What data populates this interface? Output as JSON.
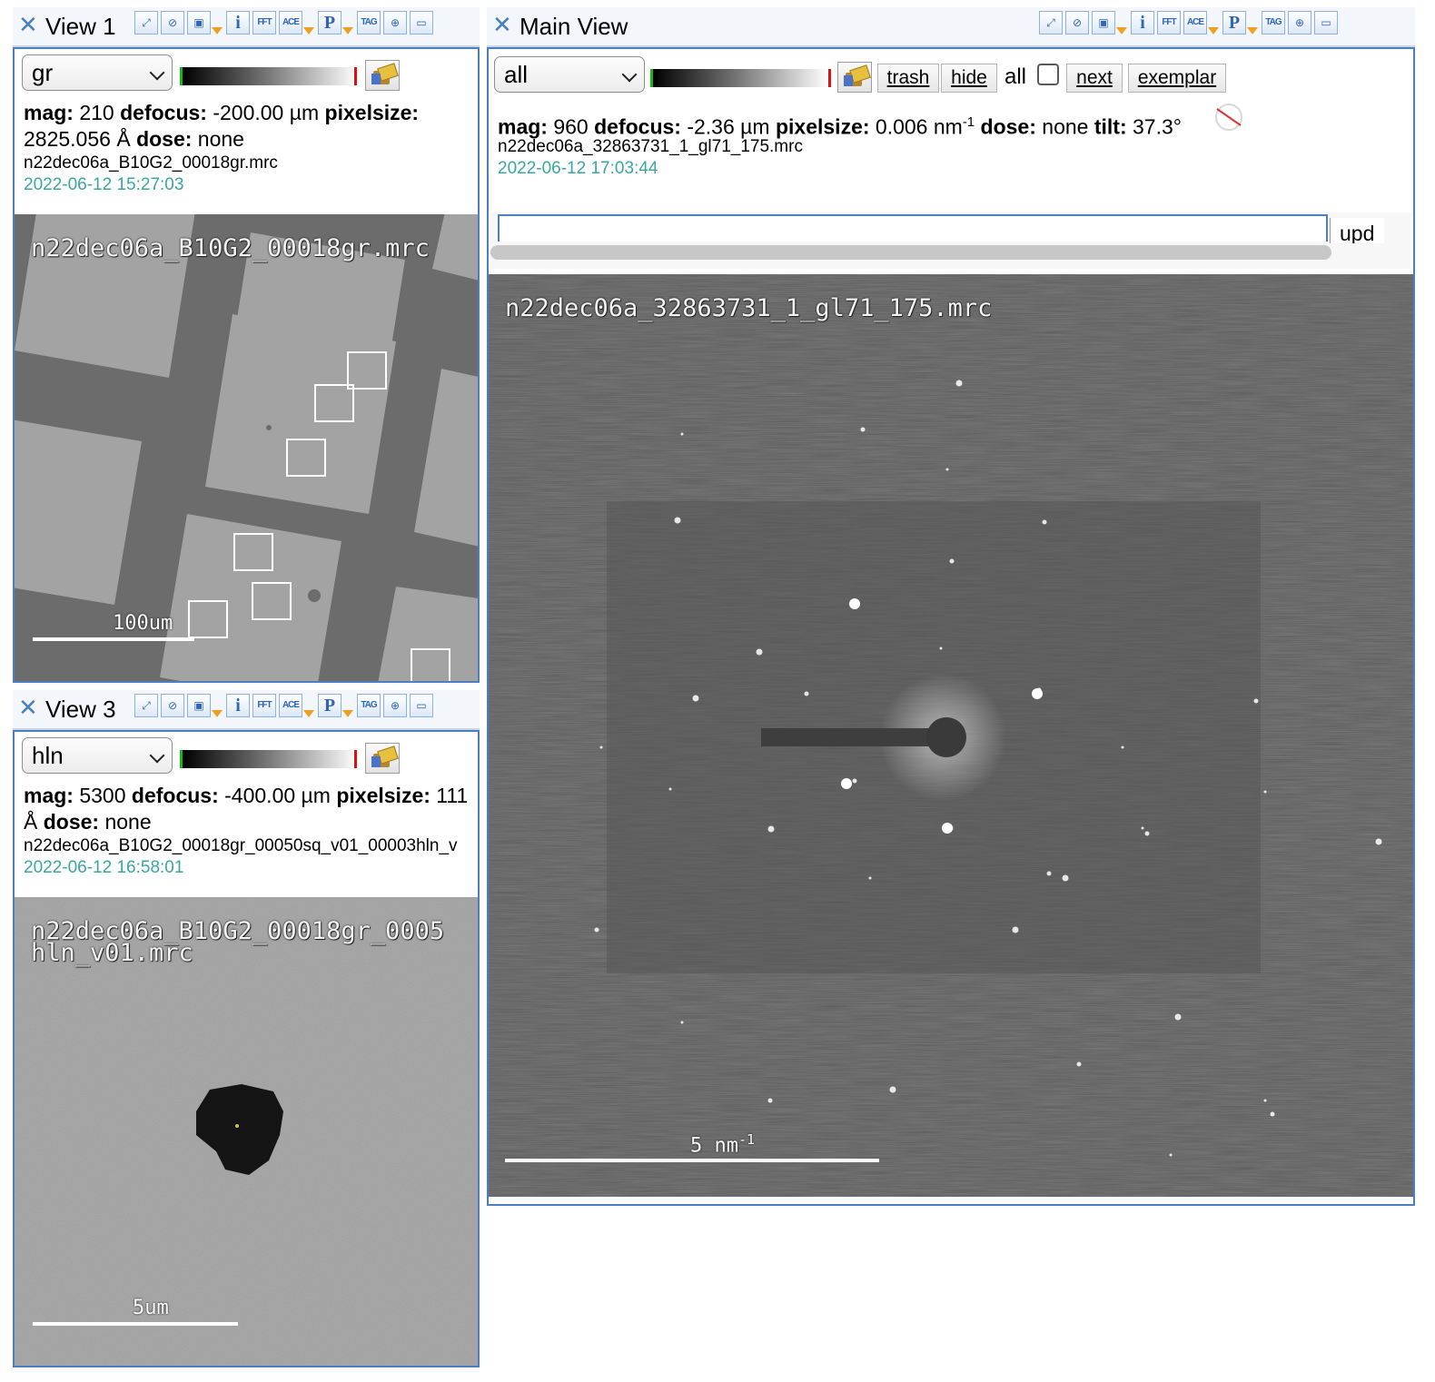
{
  "toolbar_icons": [
    "zoom-fit-icon",
    "crosshair-cancel-icon",
    "save-icon",
    "info-icon",
    "fft-icon",
    "ace-icon",
    "p-icon",
    "tag-icon",
    "target-icon",
    "panel-minimize-icon"
  ],
  "toolbar_labels": {
    "info": "i",
    "fft": "FFT",
    "ace": "ACE",
    "p": "P",
    "tag": "TAG"
  },
  "views": {
    "view1": {
      "title": "View 1",
      "preset": "gr",
      "mag_label": "mag:",
      "mag": "210",
      "defocus_label": "defocus:",
      "defocus": "-200.00 µm",
      "pixelsize_label": "pixelsize:",
      "pixelsize": "2825.056 Å",
      "dose_label": "dose:",
      "dose": "none",
      "filename": "n22dec06a_B10G2_00018gr.mrc",
      "timestamp": "2022-06-12 15:27:03",
      "overlay_filename": "n22dec06a_B10G2_00018gr.mrc",
      "scale_label": "100um"
    },
    "view3": {
      "title": "View 3",
      "preset": "hln",
      "mag_label": "mag:",
      "mag": "5300",
      "defocus_label": "defocus:",
      "defocus": "-400.00 µm",
      "pixelsize_label": "pixelsize:",
      "pixelsize": "111",
      "pixelsize_unit": "Å",
      "dose_label": "dose:",
      "dose": "none",
      "filename": "n22dec06a_B10G2_00018gr_00050sq_v01_00003hln_v",
      "timestamp": "2022-06-12 16:58:01",
      "overlay_line1": "n22dec06a_B10G2_00018gr_0005",
      "overlay_line2": "hln_v01.mrc",
      "scale_label": "5um"
    },
    "main": {
      "title": "Main View",
      "preset": "all",
      "buttons": {
        "trash": "trash",
        "hide": "hide",
        "next": "next",
        "exemplar": "exemplar"
      },
      "all_label": "all",
      "mag_label": "mag:",
      "mag": "960",
      "defocus_label": "defocus:",
      "defocus": "-2.36 µm",
      "pixelsize_label": "pixelsize:",
      "pixelsize": "0.006 nm",
      "pixelsize_exp": "-1",
      "dose_label": "dose:",
      "dose": "none",
      "tilt_label": "tilt:",
      "tilt": "37.3°",
      "filename": "n22dec06a_32863731_1_gl71_175.mrc",
      "timestamp": "2022-06-12 17:03:44",
      "comment_value": "",
      "update_label": "upd",
      "overlay_filename": "n22dec06a_32863731_1_gl71_175.mrc",
      "scale_label": "5 nm",
      "scale_exp": "-1"
    }
  },
  "colors": {
    "accent": "#4d7fc0",
    "date": "#3aa6a0",
    "titlebar": "#f3f6fb"
  }
}
